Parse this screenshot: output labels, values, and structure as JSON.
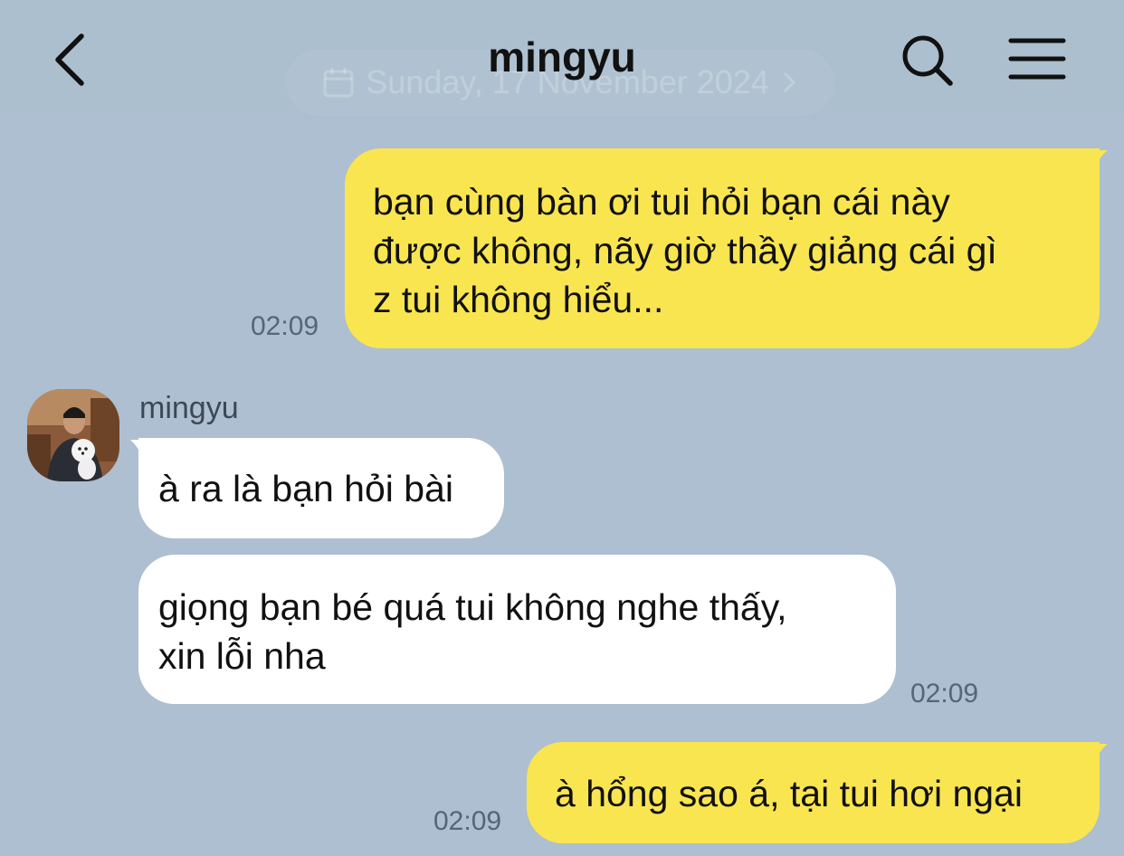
{
  "header": {
    "title": "mingyu",
    "date_banner": "Sunday, 17 November 2024",
    "icons": [
      "back-arrow-icon",
      "search-icon",
      "menu-icon",
      "calendar-icon",
      "chevron-right-icon"
    ]
  },
  "messages": [
    {
      "sender": "me",
      "lines": [
        "bạn cùng bàn ơi tui hỏi bạn cái này",
        "được không, nãy giờ thầy giảng cái gì",
        "z tui không hiểu..."
      ],
      "time": "02:09"
    },
    {
      "sender": "mingyu",
      "sender_name": "mingyu",
      "lines": [
        "à ra là bạn hỏi bài"
      ]
    },
    {
      "sender": "mingyu",
      "lines": [
        "giọng bạn bé quá tui không nghe thấy,",
        "xin lỗi nha"
      ],
      "time": "02:09"
    },
    {
      "sender": "me",
      "lines": [
        "à hổng sao á, tại tui hơi ngại"
      ],
      "time": "02:09"
    }
  ],
  "colors": {
    "background": "#adbfd0",
    "my_bubble": "#f9e550",
    "their_bubble": "#ffffff",
    "timestamp": "#566577"
  }
}
